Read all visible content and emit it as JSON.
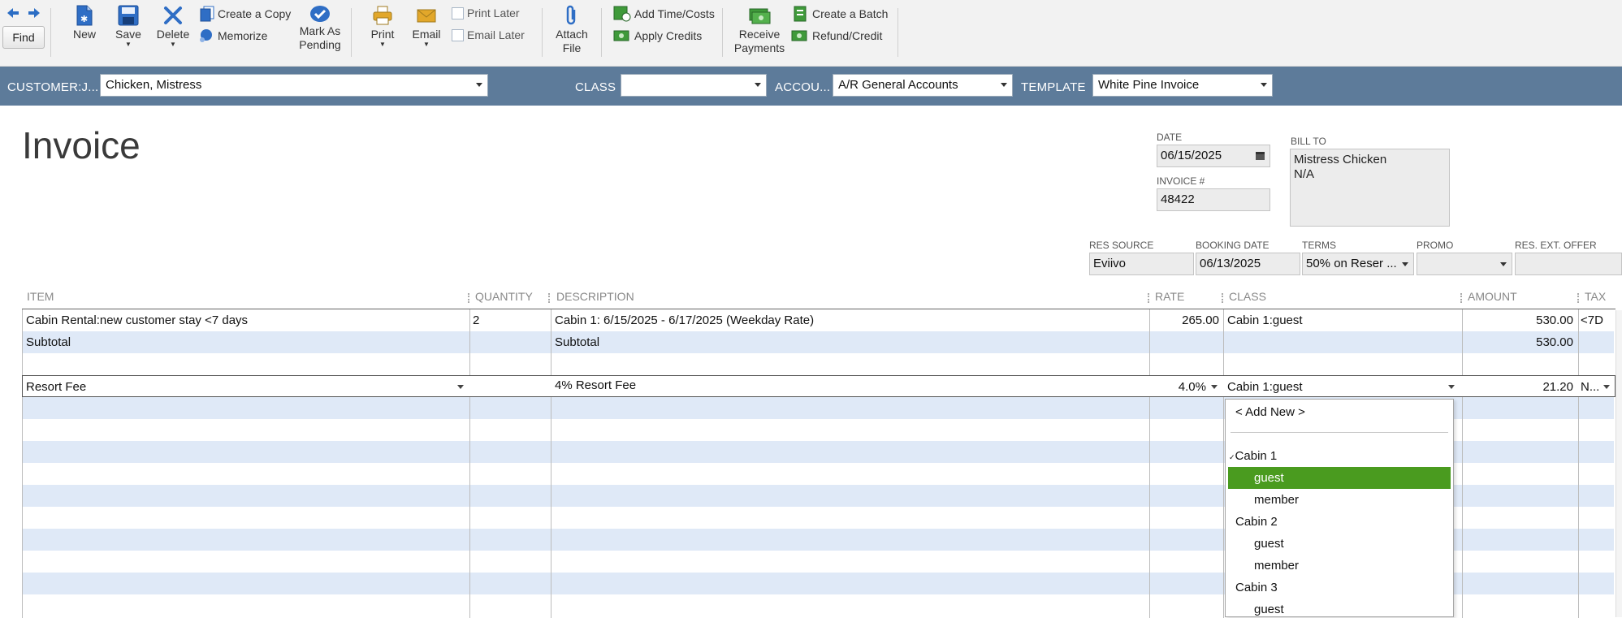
{
  "toolbar": {
    "find": "Find",
    "new": "New",
    "save": "Save",
    "delete": "Delete",
    "create_copy": "Create a Copy",
    "memorize": "Memorize",
    "mark_as_pending_1": "Mark As",
    "mark_as_pending_2": "Pending",
    "print": "Print",
    "email": "Email",
    "print_later": "Print Later",
    "email_later": "Email Later",
    "attach_file_1": "Attach",
    "attach_file_2": "File",
    "add_time_costs": "Add Time/Costs",
    "apply_credits": "Apply Credits",
    "receive_payments_1": "Receive",
    "receive_payments_2": "Payments",
    "create_batch": "Create a Batch",
    "refund_credit": "Refund/Credit"
  },
  "header": {
    "customer_label": "CUSTOMER:J...",
    "customer_value": "Chicken, Mistress",
    "class_label": "CLASS",
    "class_value": "",
    "account_label": "ACCOU...",
    "account_value": "A/R General Accounts",
    "template_label": "TEMPLATE",
    "template_value": "White Pine Invoice"
  },
  "form": {
    "title": "Invoice",
    "date_label": "DATE",
    "date_value": "06/15/2025",
    "invoice_no_label": "INVOICE #",
    "invoice_no_value": "48422",
    "bill_to_label": "BILL TO",
    "bill_to_line1": "Mistress Chicken",
    "bill_to_line2": "N/A",
    "res_source_label": "RES SOURCE",
    "res_source_value": "Eviivo",
    "booking_date_label": "BOOKING DATE",
    "booking_date_value": "06/13/2025",
    "terms_label": "TERMS",
    "terms_value": "50% on Reser ...",
    "promo_label": "PROMO",
    "promo_value": "",
    "res_ext_offer_label": "RES. EXT. OFFER",
    "res_ext_offer_value": ""
  },
  "grid": {
    "columns": {
      "item": "ITEM",
      "quantity": "QUANTITY",
      "description": "DESCRIPTION",
      "rate": "RATE",
      "class": "CLASS",
      "amount": "AMOUNT",
      "tax": "TAX"
    },
    "rows": [
      {
        "item": "Cabin Rental:new customer stay <7 days",
        "quantity": "2",
        "description": "Cabin 1: 6/15/2025 - 6/17/2025 (Weekday Rate)",
        "rate": "265.00",
        "class": "Cabin 1:guest",
        "amount": "530.00",
        "tax": "<7D"
      },
      {
        "item": "Subtotal",
        "quantity": "",
        "description": "Subtotal",
        "rate": "",
        "class": "",
        "amount": "530.00",
        "tax": ""
      },
      {
        "item": "",
        "quantity": "",
        "description": "",
        "rate": "",
        "class": "",
        "amount": "",
        "tax": ""
      },
      {
        "item": "Resort Fee",
        "quantity": "",
        "description": "4% Resort Fee",
        "rate": "4.0%",
        "class": "Cabin 1:guest",
        "amount": "21.20",
        "tax": "N..."
      }
    ]
  },
  "class_dropdown": {
    "items": [
      {
        "label": "< Add New >"
      },
      {
        "label": "Cabin 1"
      },
      {
        "label": "guest"
      },
      {
        "label": "member"
      },
      {
        "label": "Cabin 2"
      },
      {
        "label": "guest"
      },
      {
        "label": "member"
      },
      {
        "label": "Cabin 3"
      },
      {
        "label": "guest"
      }
    ],
    "selected_color": "#4a9b1f"
  },
  "colors": {
    "header_band": "#5d7b9a",
    "row_alt": "#dfe9f7",
    "toolbar_bg": "#f2f2f2"
  }
}
